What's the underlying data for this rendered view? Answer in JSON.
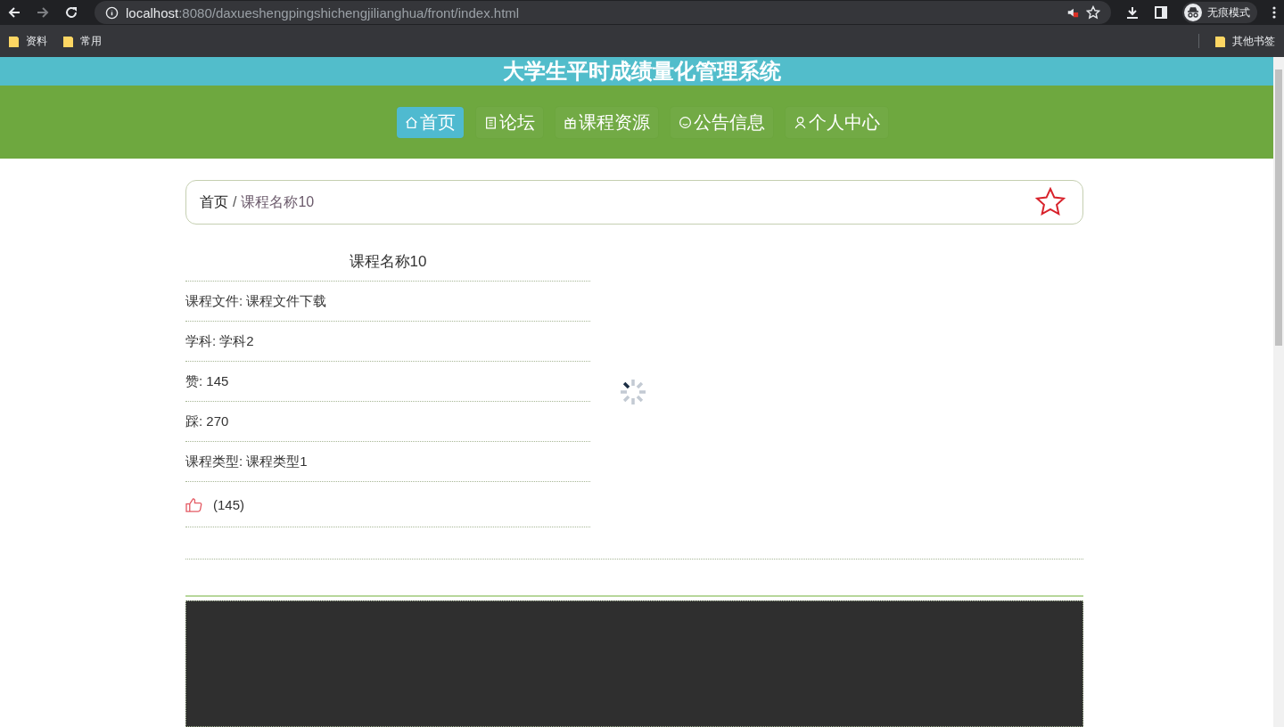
{
  "browser": {
    "url_host": "localhost",
    "url_rest": ":8080/daxueshengpingshichengjilianghua/front/index.html",
    "profile_label": "无痕模式",
    "bookmarks": [
      "资料",
      "常用"
    ],
    "other_bookmarks": "其他书签"
  },
  "site_title": "大学生平时成绩量化管理系统",
  "nav": [
    {
      "label": "首页",
      "selected": true
    },
    {
      "label": "论坛",
      "selected": false
    },
    {
      "label": "课程资源",
      "selected": false
    },
    {
      "label": "公告信息",
      "selected": false
    },
    {
      "label": "个人中心",
      "selected": false
    }
  ],
  "breadcrumb": {
    "home": "首页",
    "separator": "/",
    "current": "课程名称10",
    "favorited": false
  },
  "detail": {
    "title": "课程名称10",
    "fields": [
      {
        "label": "课程文件:",
        "value": "课程文件下载"
      },
      {
        "label": "学科:",
        "value": "学科2"
      },
      {
        "label": "赞:",
        "value": "145"
      },
      {
        "label": "踩:",
        "value": "270"
      },
      {
        "label": "课程类型:",
        "value": "课程类型1"
      }
    ],
    "like_count": "(145)"
  }
}
